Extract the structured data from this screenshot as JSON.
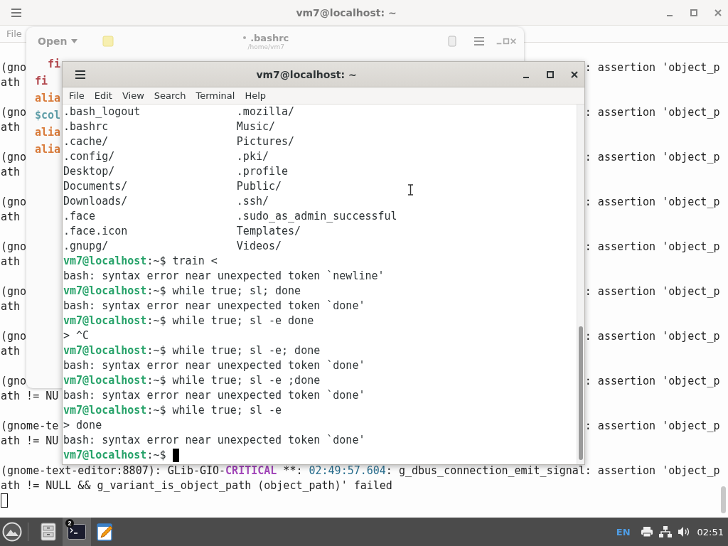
{
  "back_terminal": {
    "title": "vm7@localhost: ~",
    "menu": [
      "File"
    ],
    "lines": [
      {
        "kind": "text",
        "left": "(gno",
        "right": ": assertion 'object_p"
      },
      {
        "kind": "text",
        "left": "ath"
      },
      {
        "kind": "blank"
      },
      {
        "kind": "text",
        "left": "(gno",
        "right": ": assertion 'object_p"
      },
      {
        "kind": "text",
        "left": "ath"
      },
      {
        "kind": "blank"
      },
      {
        "kind": "text",
        "left": "(gno",
        "right": ": assertion 'object_p"
      },
      {
        "kind": "text",
        "left": "ath"
      },
      {
        "kind": "blank"
      },
      {
        "kind": "text",
        "left": "(gno",
        "right": ": assertion 'object_p"
      },
      {
        "kind": "text",
        "left": "ath"
      },
      {
        "kind": "blank"
      },
      {
        "kind": "text",
        "left": "(gno",
        "right": ": assertion 'object_p"
      },
      {
        "kind": "text",
        "left": "ath"
      },
      {
        "kind": "blank"
      },
      {
        "kind": "text",
        "left": "(gno",
        "right": ": assertion 'object_p"
      },
      {
        "kind": "text",
        "left": "ath"
      },
      {
        "kind": "blank"
      },
      {
        "kind": "text",
        "left": "(gno",
        "right": ": assertion 'object_p"
      },
      {
        "kind": "text",
        "left": "ath"
      },
      {
        "kind": "blank"
      },
      {
        "kind": "text",
        "left": "(gno",
        "right": ": assertion 'object_p"
      },
      {
        "kind": "text",
        "left": "ath != NU"
      },
      {
        "kind": "blank"
      },
      {
        "kind": "text",
        "left": "(gnome-te",
        "right": ": assertion 'object_p"
      },
      {
        "kind": "text",
        "left": "ath != NU"
      },
      {
        "kind": "blank"
      },
      {
        "kind": "segments",
        "segments": [
          {
            "kind": "plain",
            "text": "(gnome-text-editor:8807): GLib-GIO-"
          },
          {
            "kind": "critical",
            "text": "CRITICAL"
          },
          {
            "kind": "plain",
            "text": " **: "
          },
          {
            "kind": "time",
            "text": "02:49:57.604"
          },
          {
            "kind": "plain",
            "text": ": g_dbus_connection_emit_signal: assertion 'object_p"
          }
        ]
      },
      {
        "kind": "text",
        "left": "ath != NULL && g_variant_is_object_path (object_path)' failed"
      },
      {
        "kind": "cursor"
      }
    ]
  },
  "editor": {
    "open_button": "Open",
    "modified": true,
    "title": ".bashrc",
    "subtitle": "/home/vm7",
    "lines": [
      {
        "kind": "keyword",
        "text": "  fi"
      },
      {
        "kind": "keyword",
        "text": "fi"
      },
      {
        "kind": "alias",
        "text": "alia"
      },
      {
        "kind": "variable",
        "text": "$col"
      },
      {
        "kind": "alias",
        "text": "alia"
      },
      {
        "kind": "alias",
        "text": "alia"
      }
    ]
  },
  "terminal": {
    "title": "vm7@localhost: ~",
    "menu": [
      "File",
      "Edit",
      "View",
      "Search",
      "Terminal",
      "Help"
    ],
    "lines": [
      {
        "kind": "ls",
        "cells": [
          ".bash_logout",
          ".mozilla/"
        ]
      },
      {
        "kind": "ls",
        "cells": [
          ".bashrc",
          "Music/"
        ]
      },
      {
        "kind": "ls",
        "cells": [
          ".cache/",
          "Pictures/"
        ]
      },
      {
        "kind": "ls",
        "cells": [
          ".config/",
          ".pki/"
        ]
      },
      {
        "kind": "ls",
        "cells": [
          "Desktop/",
          ".profile"
        ]
      },
      {
        "kind": "ls",
        "cells": [
          "Documents/",
          "Public/"
        ]
      },
      {
        "kind": "ls",
        "cells": [
          "Downloads/",
          ".ssh/"
        ]
      },
      {
        "kind": "ls",
        "cells": [
          ".face",
          ".sudo_as_admin_successful"
        ]
      },
      {
        "kind": "ls",
        "cells": [
          ".face.icon",
          "Templates/"
        ]
      },
      {
        "kind": "ls",
        "cells": [
          ".gnupg/",
          "Videos/"
        ]
      },
      {
        "kind": "prompt",
        "user": "vm7@localhost",
        "path": ":~$",
        "command": "train <",
        "cursor": false
      },
      {
        "kind": "output",
        "text": "bash: syntax error near unexpected token `newline'"
      },
      {
        "kind": "prompt",
        "user": "vm7@localhost",
        "path": ":~$",
        "command": "while true; sl; done",
        "cursor": false
      },
      {
        "kind": "output",
        "text": "bash: syntax error near unexpected token `done'"
      },
      {
        "kind": "prompt",
        "user": "vm7@localhost",
        "path": ":~$",
        "command": "while true; sl -e done",
        "cursor": false
      },
      {
        "kind": "output",
        "text": "> ^C"
      },
      {
        "kind": "prompt",
        "user": "vm7@localhost",
        "path": ":~$",
        "command": "while true; sl -e; done",
        "cursor": false
      },
      {
        "kind": "output",
        "text": "bash: syntax error near unexpected token `done'"
      },
      {
        "kind": "prompt",
        "user": "vm7@localhost",
        "path": ":~$",
        "command": "while true; sl -e ;done",
        "cursor": false
      },
      {
        "kind": "output",
        "text": "bash: syntax error near unexpected token `done'"
      },
      {
        "kind": "prompt",
        "user": "vm7@localhost",
        "path": ":~$",
        "command": "while true; sl -e",
        "cursor": false
      },
      {
        "kind": "output",
        "text": "> done"
      },
      {
        "kind": "output",
        "text": "bash: syntax error near unexpected token `done'"
      },
      {
        "kind": "prompt",
        "user": "vm7@localhost",
        "path": ":~$",
        "cursor": true
      }
    ]
  },
  "taskbar": {
    "apps": [
      {
        "kind": "files",
        "selected": false
      },
      {
        "kind": "terminal",
        "selected": true,
        "badge": "2"
      },
      {
        "kind": "editor",
        "selected": false
      }
    ],
    "language": "EN",
    "clock": "02:51"
  }
}
